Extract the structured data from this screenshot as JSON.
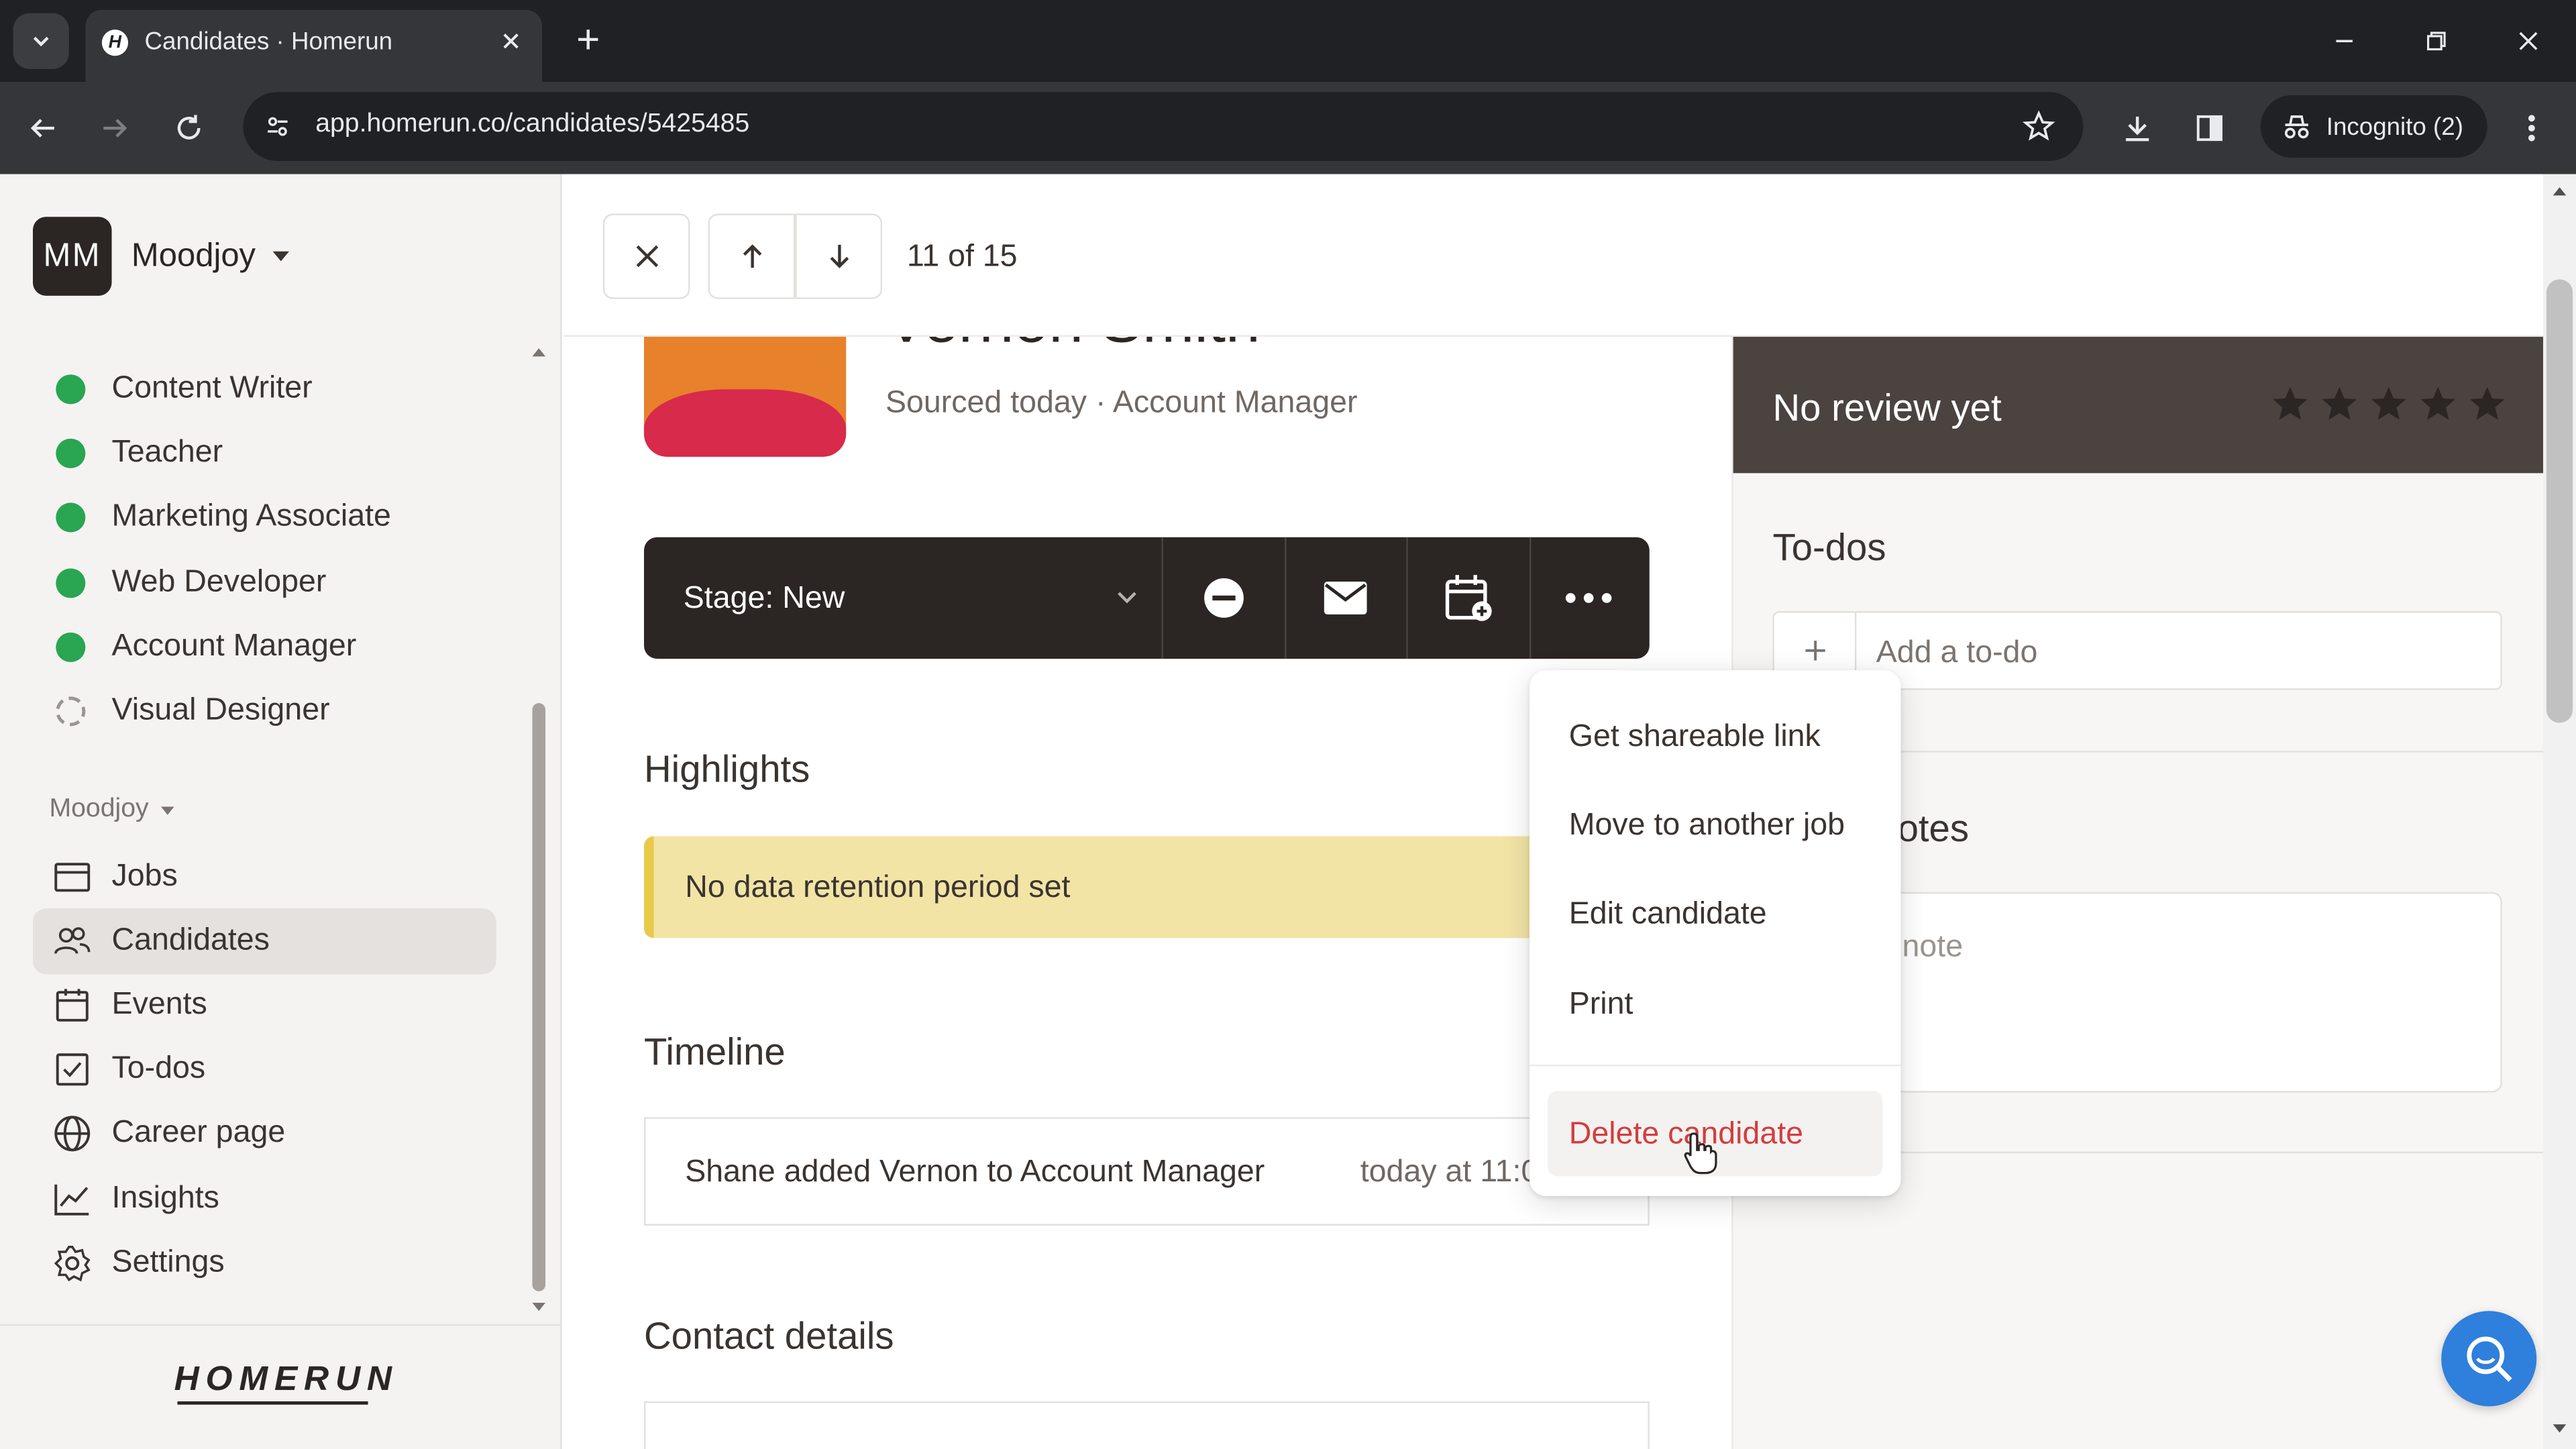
{
  "browser": {
    "tab_title": "Candidates · Homerun",
    "favicon_letter": "H",
    "url": "app.homerun.co/candidates/5425485",
    "incognito_label": "Incognito (2)"
  },
  "sidebar": {
    "org_initials": "MM",
    "org_name": "Moodjoy",
    "jobs": [
      {
        "label": "Content Writer",
        "status": "published"
      },
      {
        "label": "Teacher",
        "status": "published"
      },
      {
        "label": "Marketing Associate",
        "status": "published"
      },
      {
        "label": "Web Developer",
        "status": "published"
      },
      {
        "label": "Account Manager",
        "status": "published"
      },
      {
        "label": "Visual Designer",
        "status": "draft"
      }
    ],
    "section_label": "Moodjoy",
    "nav": [
      {
        "label": "Jobs",
        "icon": "briefcase-icon"
      },
      {
        "label": "Candidates",
        "icon": "people-icon",
        "active": true
      },
      {
        "label": "Events",
        "icon": "calendar-icon"
      },
      {
        "label": "To-dos",
        "icon": "checkbox-icon"
      },
      {
        "label": "Career page",
        "icon": "globe-icon"
      },
      {
        "label": "Insights",
        "icon": "chart-line-icon"
      },
      {
        "label": "Settings",
        "icon": "gear-icon"
      }
    ],
    "logo_text": "HOMERUN"
  },
  "header": {
    "counter": "11 of 15"
  },
  "candidate": {
    "name": "Vernon Smith",
    "subtitle": "Sourced today · Account Manager",
    "stage_label": "Stage: New",
    "highlights_title": "Highlights",
    "retention_notice": "No data retention period set",
    "timeline_title": "Timeline",
    "timeline_entry": "Shane added Vernon to Account Manager",
    "timeline_time": "today at 11:0",
    "contact_title": "Contact details"
  },
  "right_panel": {
    "review_label": "No review yet",
    "review_stars": 5,
    "todos_title": "To-dos",
    "todo_placeholder": "Add a to-do",
    "notes_title_visible": "otes",
    "note_placeholder_visible": "n note"
  },
  "menu": {
    "items": [
      "Get shareable link",
      "Move to another job",
      "Edit candidate",
      "Print"
    ],
    "danger_item": "Delete candidate"
  },
  "colors": {
    "accent_green": "#2aa551",
    "danger_red": "#d43d3d",
    "fab_blue": "#2f7fdc",
    "stage_bar": "#2b2624"
  }
}
